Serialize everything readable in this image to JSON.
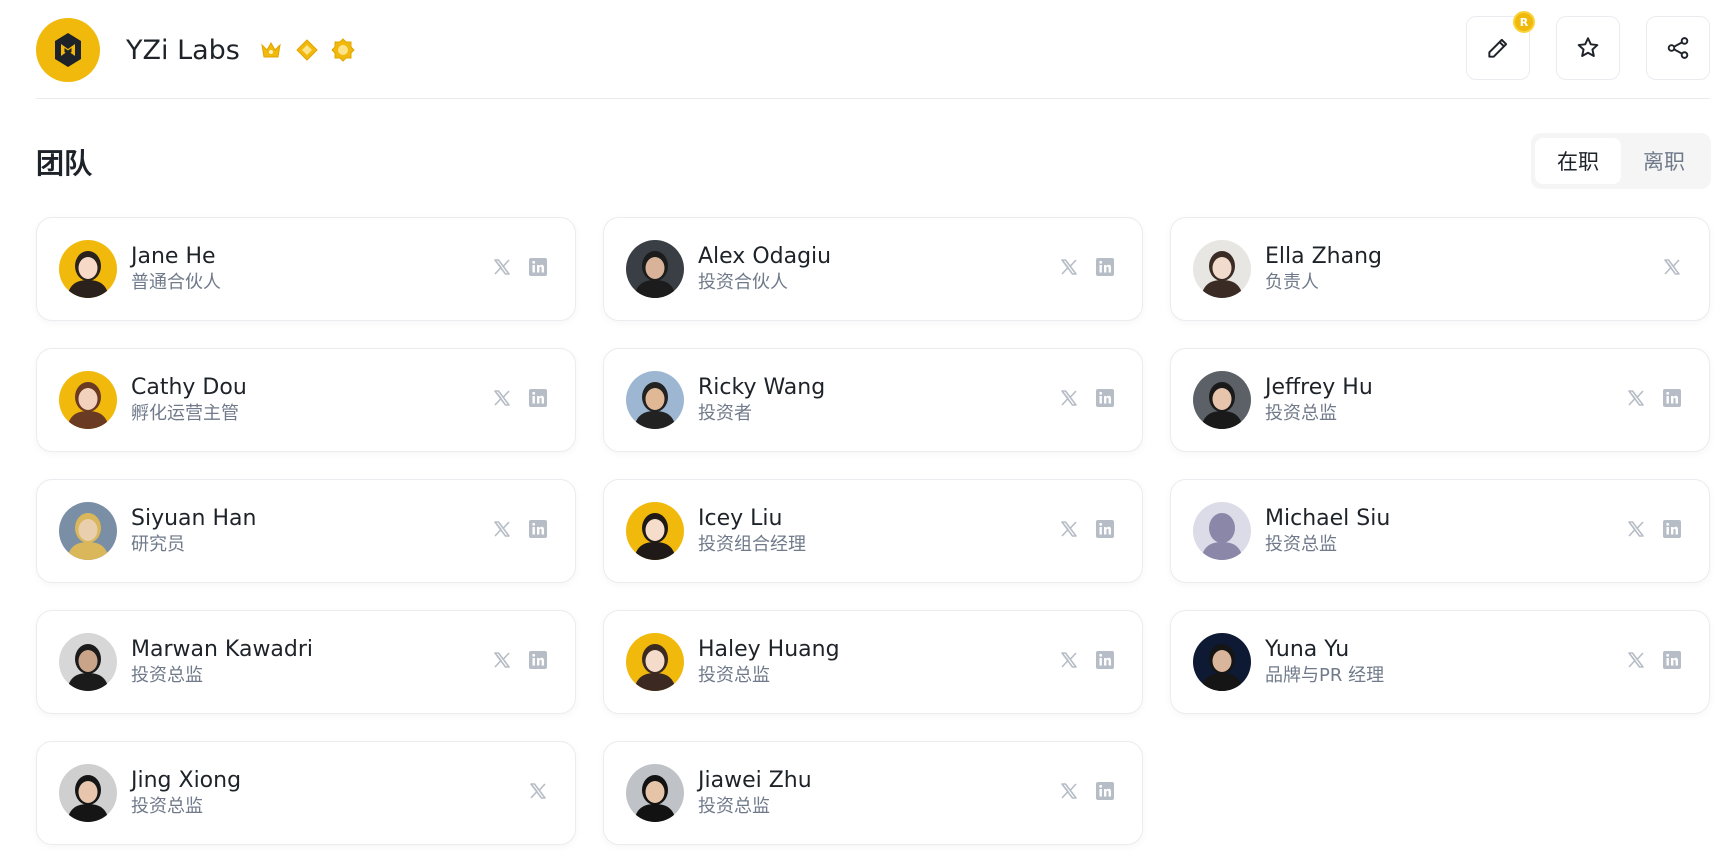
{
  "header": {
    "title": "YZi Labs",
    "badges": [
      "crown-badge-icon",
      "diamond-badge-icon",
      "medal-badge-icon"
    ],
    "coin_label": "R",
    "accent": "#f0b90b"
  },
  "team": {
    "section_title": "团队",
    "tabs": [
      {
        "label": "在职",
        "active": true
      },
      {
        "label": "离职",
        "active": false
      }
    ],
    "members": [
      {
        "name": "Jane He",
        "role": "普通合伙人",
        "x": true,
        "linkedin": true,
        "avatar_bg": "#f0b90b",
        "skin": "#f6dac7",
        "hair": "#2a211c"
      },
      {
        "name": "Alex Odagiu",
        "role": "投资合伙人",
        "x": true,
        "linkedin": true,
        "avatar_bg": "#3a3f45",
        "skin": "#d8b39a",
        "hair": "#1c1c1c"
      },
      {
        "name": "Ella Zhang",
        "role": "负责人",
        "x": true,
        "linkedin": false,
        "avatar_bg": "#e8e6e3",
        "skin": "#f1dbcd",
        "hair": "#3a2c25"
      },
      {
        "name": "Cathy Dou",
        "role": "孵化运营主管",
        "x": true,
        "linkedin": true,
        "avatar_bg": "#f0b90b",
        "skin": "#f3d2bd",
        "hair": "#6b3a23"
      },
      {
        "name": "Ricky Wang",
        "role": "投资者",
        "x": true,
        "linkedin": true,
        "avatar_bg": "#9db7d3",
        "skin": "#e0b896",
        "hair": "#222222"
      },
      {
        "name": "Jeffrey Hu",
        "role": "投资总监",
        "x": true,
        "linkedin": true,
        "avatar_bg": "#5c6168",
        "skin": "#e7c5ad",
        "hair": "#1a1a1a"
      },
      {
        "name": "Siyuan Han",
        "role": "研究员",
        "x": true,
        "linkedin": true,
        "avatar_bg": "#7a8ea6",
        "skin": "#e9cfae",
        "hair": "#d9b75a"
      },
      {
        "name": "Icey Liu",
        "role": "投资组合经理",
        "x": true,
        "linkedin": true,
        "avatar_bg": "#f0b90b",
        "skin": "#f5dccb",
        "hair": "#1f1a17"
      },
      {
        "name": "Michael Siu",
        "role": "投资总监",
        "x": true,
        "linkedin": true,
        "avatar_bg": "#dcdbe8",
        "skin": "#8b87a8",
        "hair": "#8b87a8"
      },
      {
        "name": "Marwan Kawadri",
        "role": "投资总监",
        "x": true,
        "linkedin": true,
        "avatar_bg": "#d7d7d7",
        "skin": "#c9a489",
        "hair": "#1b1b1b"
      },
      {
        "name": "Haley Huang",
        "role": "投资总监",
        "x": true,
        "linkedin": true,
        "avatar_bg": "#f0b90b",
        "skin": "#f5dcca",
        "hair": "#3c2a22"
      },
      {
        "name": "Yuna Yu",
        "role": "品牌与PR 经理",
        "x": true,
        "linkedin": true,
        "avatar_bg": "#0e1a33",
        "skin": "#d9b59b",
        "hair": "#151515"
      },
      {
        "name": "Jing Xiong",
        "role": "投资总监",
        "x": true,
        "linkedin": false,
        "avatar_bg": "#cfcfcf",
        "skin": "#e8c6ae",
        "hair": "#151515"
      },
      {
        "name": "Jiawei Zhu",
        "role": "投资总监",
        "x": true,
        "linkedin": true,
        "avatar_bg": "#bfc3c7",
        "skin": "#e6c4a8",
        "hair": "#121212"
      }
    ]
  }
}
